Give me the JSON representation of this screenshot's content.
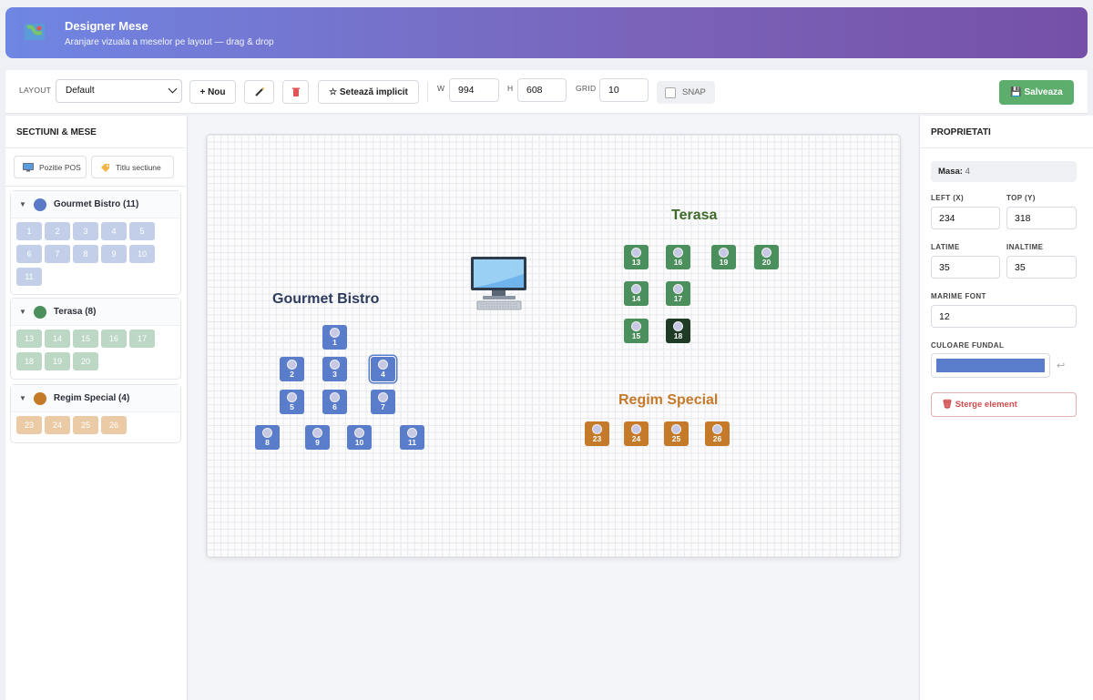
{
  "header": {
    "title": "Designer Mese",
    "subtitle": "Aranjare vizuala a meselor pe layout — drag & drop",
    "icon": "map-icon"
  },
  "toolbar": {
    "layout_label": "LAYOUT",
    "layout_value": "Default",
    "new_label": "+ Nou",
    "edit_icon": "pencil-icon",
    "delete_icon": "trash-icon",
    "default_label": "☆ Setează implicit",
    "w_label": "W",
    "w_value": "994",
    "h_label": "H",
    "h_value": "608",
    "grid_label": "GRID",
    "grid_value": "10",
    "snap_label": "SNAP",
    "save_label": "💾 Salveaza"
  },
  "left": {
    "title": "SECTIUNI & MESE",
    "pos_label": "Pozitie POS",
    "title_label": "Titlu sectiune",
    "groups": [
      {
        "name": "Gourmet Bistro (11)",
        "color": "#5b7bc8",
        "chip": "#c3cfe8",
        "tables": [
          "1",
          "2",
          "3",
          "4",
          "5",
          "6",
          "7",
          "8",
          "9",
          "10",
          "11"
        ]
      },
      {
        "name": "Terasa (8)",
        "color": "#4a8f5c",
        "chip": "#bcd7c3",
        "tables": [
          "13",
          "14",
          "15",
          "16",
          "17",
          "18",
          "19",
          "20"
        ]
      },
      {
        "name": "Regim Special (4)",
        "color": "#c57a2a",
        "chip": "#ebcba6",
        "tables": [
          "23",
          "24",
          "25",
          "26"
        ]
      }
    ]
  },
  "canvas": {
    "sections": [
      {
        "name": "Gourmet Bistro",
        "color": "#2d3b5e"
      },
      {
        "name": "Terasa",
        "color": "#3f6b2a"
      },
      {
        "name": "Regim Special",
        "color": "#c57a2a"
      }
    ],
    "tables": [
      "1",
      "2",
      "3",
      "4",
      "5",
      "6",
      "7",
      "8",
      "9",
      "10",
      "11",
      "13",
      "14",
      "15",
      "16",
      "17",
      "18",
      "19",
      "20",
      "23",
      "24",
      "25",
      "26"
    ]
  },
  "props": {
    "title": "PROPRIETATI",
    "masa_label": "Masa:",
    "masa_value": "4",
    "left_label": "LEFT (X)",
    "left_value": "234",
    "top_label": "TOP (Y)",
    "top_value": "318",
    "width_label": "LATIME",
    "width_value": "35",
    "height_label": "INALTIME",
    "height_value": "35",
    "font_label": "MARIME FONT",
    "font_value": "12",
    "bg_label": "CULOARE FUNDAL",
    "bg_value": "#5a7dcb",
    "delete_label": "🗑 Sterge element"
  }
}
